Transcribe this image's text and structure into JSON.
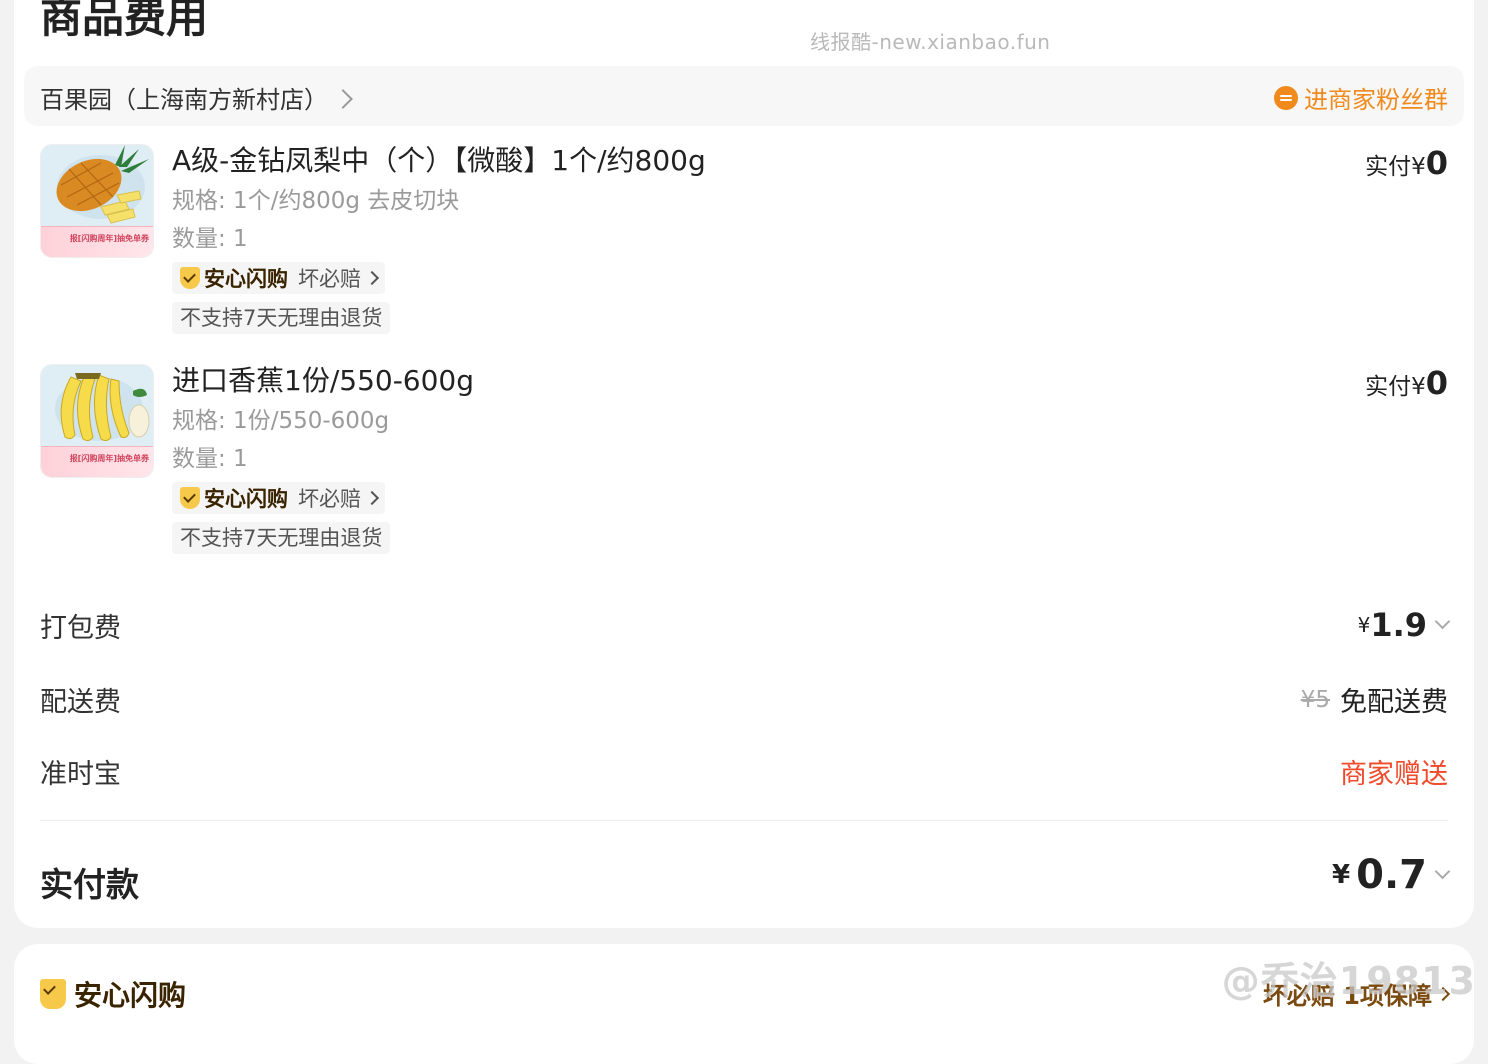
{
  "header": {
    "section_title": "商品费用",
    "watermark": "线报酷-new.xianbao.fun"
  },
  "store": {
    "name": "百果园（上海南方新村店）",
    "fan_group_label": "进商家粉丝群"
  },
  "items": [
    {
      "title": "A级-金钻凤梨中（个）【微酸】1个/约800g",
      "spec": "规格: 1个/约800g 去皮切块",
      "qty": "数量: 1",
      "guarantee_name": "安心闪购",
      "guarantee_text": "坏必赔",
      "no_return": "不支持7天无理由退货",
      "paid_label": "实付",
      "paid_yen": "¥",
      "paid_value": "0",
      "thumb_promo": "报[闪购周年]抽免单券",
      "fruit": "pineapple"
    },
    {
      "title": "进口香蕉1份/550-600g",
      "spec": "规格: 1份/550-600g",
      "qty": "数量: 1",
      "guarantee_name": "安心闪购",
      "guarantee_text": "坏必赔",
      "no_return": "不支持7天无理由退货",
      "paid_label": "实付",
      "paid_yen": "¥",
      "paid_value": "0",
      "thumb_promo": "报[闪购周年]抽免单券",
      "fruit": "banana"
    }
  ],
  "fees": {
    "packing_label": "打包费",
    "packing_yen": "¥",
    "packing_value": "1.9",
    "delivery_label": "配送费",
    "delivery_original": "¥5",
    "delivery_value": "免配送费",
    "ontime_label": "准时宝",
    "ontime_value": "商家赠送"
  },
  "total": {
    "label": "实付款",
    "yen": "¥",
    "value": "0.7"
  },
  "anxin": {
    "title": "安心闪购",
    "right_label": "坏必赔 1项保障"
  },
  "weibo_watermark": "@乔治19813",
  "colors": {
    "accent_orange": "#f08a1c",
    "red": "#f04a2a",
    "shield_yellow": "#f7c94b"
  }
}
